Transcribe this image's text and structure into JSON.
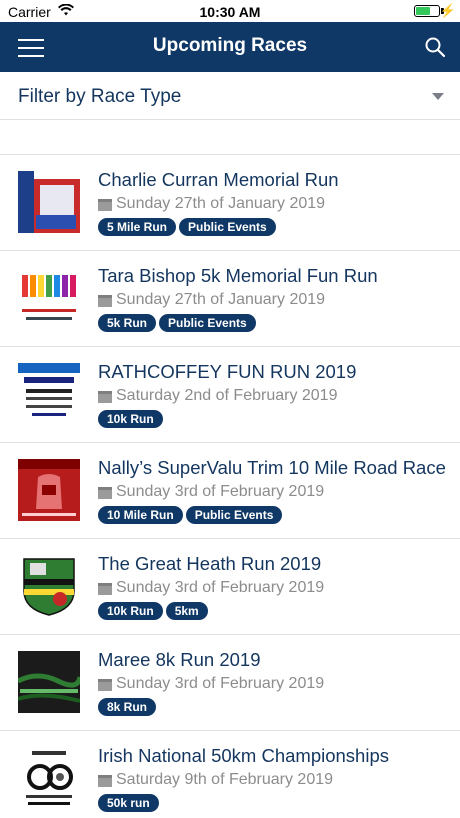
{
  "status": {
    "carrier": "Carrier",
    "time": "10:30 AM"
  },
  "navbar": {
    "title": "Upcoming Races"
  },
  "filter": {
    "label": "Filter by Race Type"
  },
  "races": [
    {
      "name": "Charlie Curran Memorial Run",
      "date": "Sunday 27th of January 2019",
      "tags": [
        "5 Mile Run",
        "Public Events"
      ]
    },
    {
      "name": "Tara Bishop 5k Memorial Fun Run",
      "date": "Sunday 27th of January 2019",
      "tags": [
        "5k Run",
        "Public Events"
      ]
    },
    {
      "name": "RATHCOFFEY FUN RUN 2019",
      "date": "Saturday 2nd of February 2019",
      "tags": [
        "10k Run"
      ]
    },
    {
      "name": "Nally’s SuperValu Trim 10 Mile Road Race",
      "date": "Sunday 3rd of February 2019",
      "tags": [
        "10 Mile Run",
        "Public Events"
      ]
    },
    {
      "name": "The Great Heath Run 2019",
      "date": "Sunday 3rd of February 2019",
      "tags": [
        "10k Run",
        "5km"
      ]
    },
    {
      "name": "Maree 8k Run 2019",
      "date": "Sunday 3rd of February 2019",
      "tags": [
        "8k Run"
      ]
    },
    {
      "name": "Irish National 50km Championships",
      "date": "Saturday 9th of February 2019",
      "tags": [
        "50k run"
      ]
    }
  ],
  "icons": {
    "menu": "menu-icon",
    "search": "search-icon",
    "calendar": "calendar-icon",
    "dropdown": "chevron-down-icon"
  },
  "colors": {
    "navbar": "#0f3866",
    "tag": "#0f3866",
    "title_text": "#14365e",
    "date_text": "#8c8c8c"
  }
}
